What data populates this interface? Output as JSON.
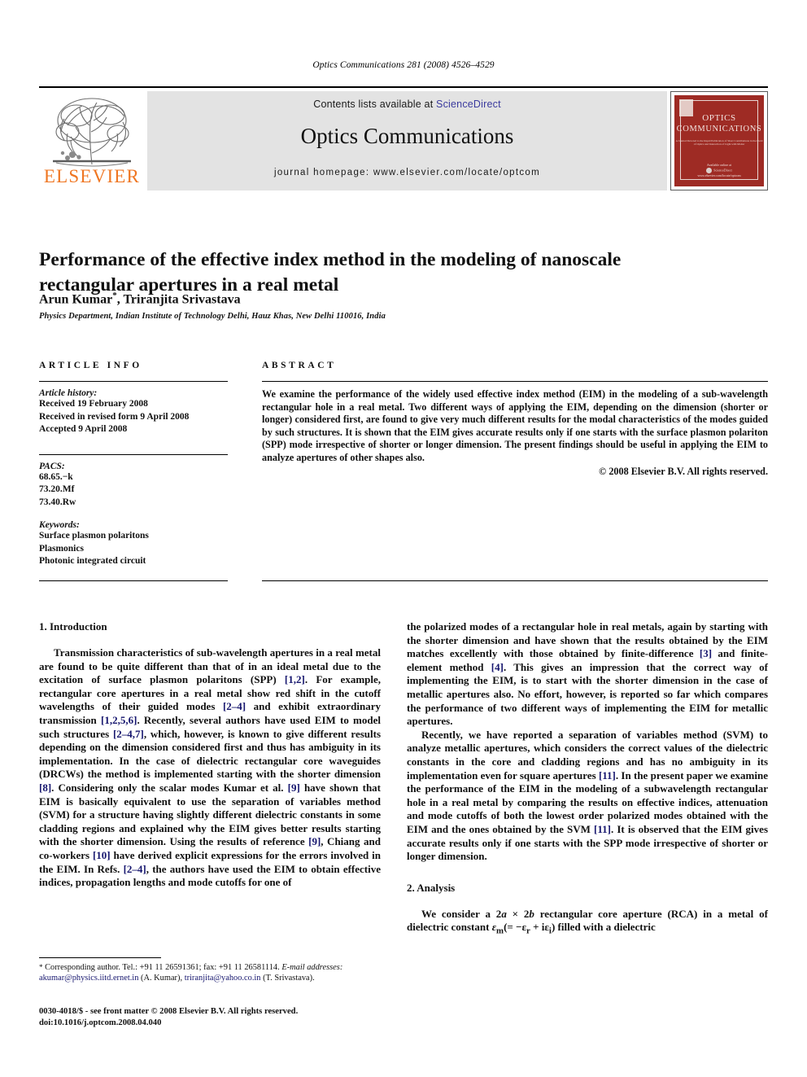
{
  "running_head": "Optics Communications 281 (2008) 4526–4529",
  "masthead": {
    "publisher_name": "ELSEVIER",
    "contents_prefix": "Contents lists available at ",
    "sciencedirect": "ScienceDirect",
    "journal_title": "Optics Communications",
    "homepage": "journal homepage: www.elsevier.com/locate/optcom",
    "cover": {
      "line1": "OPTICS",
      "line2": "COMMUNICATIONS",
      "subtitle": "A Journal Devoted to the Rapid Publication of Short Contributions in the Field of Optics and Interaction of Light with Matter",
      "footer": "Available online at",
      "footer2": "ScienceDirect",
      "footer3": "www.elsevier.com/locate/optcom"
    },
    "colors": {
      "band": "#e3e3e3",
      "elsevier_orange": "#ef7622",
      "link_blue": "#3b3b9e",
      "cover_red": "#9e2b24"
    }
  },
  "article": {
    "title": "Performance of the effective index method in the modeling of nanoscale rectangular apertures in a real metal",
    "authors": "Arun Kumar",
    "author_marker": "*",
    "authors_rest": ", Triranjita Srivastava",
    "affiliation": "Physics Department, Indian Institute of Technology Delhi, Hauz Khas, New Delhi 110016, India"
  },
  "article_info": {
    "heading": "ARTICLE INFO",
    "history_label": "Article history:",
    "history": [
      "Received 19 February 2008",
      "Received in revised form 9 April 2008",
      "Accepted 9 April 2008"
    ],
    "pacs_label": "PACS:",
    "pacs": [
      "68.65.−k",
      "73.20.Mf",
      "73.40.Rw"
    ],
    "keywords_label": "Keywords:",
    "keywords": [
      "Surface plasmon polaritons",
      "Plasmonics",
      "Photonic integrated circuit"
    ]
  },
  "abstract": {
    "heading": "ABSTRACT",
    "text": "We examine the performance of the widely used effective index method (EIM) in the modeling of a sub-wavelength rectangular hole in a real metal. Two different ways of applying the EIM, depending on the dimension (shorter or longer) considered first, are found to give very much different results for the modal characteristics of the modes guided by such structures. It is shown that the EIM gives accurate results only if one starts with the surface plasmon polariton (SPP) mode irrespective of shorter or longer dimension. The present findings should be useful in applying the EIM to analyze apertures of other shapes also.",
    "copyright": "© 2008 Elsevier B.V. All rights reserved."
  },
  "body": {
    "section1_heading": "1. Introduction",
    "section1_p1_a": "Transmission characteristics of sub-wavelength apertures in a real metal are found to be quite different than that of in an ideal metal due to the excitation of surface plasmon polaritons (SPP) ",
    "section1_p1_r1": "[1,2]",
    "section1_p1_b": ". For example, rectangular core apertures in a real metal show red shift in the cutoff wavelengths of their guided modes ",
    "section1_p1_r2": "[2–4]",
    "section1_p1_c": " and exhibit extraordinary transmission ",
    "section1_p1_r3": "[1,2,5,6]",
    "section1_p1_d": ". Recently, several authors have used EIM to model such structures ",
    "section1_p1_r4": "[2–4,7]",
    "section1_p1_e": ", which, however, is known to give different results depending on the dimension considered first and thus has ambiguity in its implementation. In the case of dielectric rectangular core waveguides (DRCWs) the method is implemented starting with the shorter dimension ",
    "section1_p1_r5": "[8]",
    "section1_p1_f": ". Considering only the scalar modes Kumar et al. ",
    "section1_p1_r6": "[9]",
    "section1_p1_g": " have shown that EIM is basically equivalent to use the separation of variables method (SVM) for a structure having slightly different dielectric constants in some cladding regions and explained why the EIM gives better results starting with the shorter dimension. Using the results of reference ",
    "section1_p1_r7": "[9]",
    "section1_p1_h": ", Chiang and co-workers ",
    "section1_p1_r8": "[10]",
    "section1_p1_i": " have derived explicit expressions for the errors involved in the EIM. In Refs. ",
    "section1_p1_r9": "[2–4]",
    "section1_p1_j": ", the authors have used the EIM to obtain effective indices, propagation lengths and mode cutoffs for one of",
    "right_p1_a": "the polarized modes of a rectangular hole in real metals, again by starting with the shorter dimension and have shown that the results obtained by the EIM matches excellently with those obtained by finite-difference ",
    "right_p1_r1": "[3]",
    "right_p1_b": " and finite-element method ",
    "right_p1_r2": "[4]",
    "right_p1_c": ". This gives an impression that the correct way of implementing the EIM, is to start with the shorter dimension in the case of metallic apertures also. No effort, however, is reported so far which compares the performance of two different ways of implementing the EIM for metallic apertures.",
    "right_p2_a": "Recently, we have reported a separation of variables method (SVM) to analyze metallic apertures, which considers the correct values of the dielectric constants in the core and cladding regions and has no ambiguity in its implementation even for square apertures ",
    "right_p2_r1": "[11]",
    "right_p2_b": ". In the present paper we examine the performance of the EIM in the modeling of a subwavelength rectangular hole in a real metal by comparing the results on effective indices, attenuation and mode cutoffs of both the lowest order polarized modes obtained with the EIM and the ones obtained by the SVM ",
    "right_p2_r2": "[11]",
    "right_p2_c": ". It is observed that the EIM gives accurate results only if one starts with the SPP mode irrespective of shorter or longer dimension.",
    "section2_heading": "2. Analysis",
    "section2_p1_a": "We consider a 2",
    "section2_p1_i1": "a",
    "section2_p1_b": " × 2",
    "section2_p1_i2": "b",
    "section2_p1_c": " rectangular core aperture (RCA) in a metal of dielectric constant ",
    "section2_p1_eps": "ε",
    "section2_p1_sub": "m",
    "section2_p1_d": "(= −ε",
    "section2_p1_subr": "r",
    "section2_p1_e": " + iε",
    "section2_p1_subi": "i",
    "section2_p1_f": ") filled with a dielectric"
  },
  "footnote": {
    "marker": "*",
    "corresponding": " Corresponding author. Tel.: +91 11 26591361; fax: +91 11 26581114.",
    "email_label": "E-mail addresses:",
    "email1": "akumar@physics.iitd.ernet.in",
    "email1_owner": " (A. Kumar), ",
    "email2": "triranjita@yahoo.co.in",
    "email2_owner": " (T. Srivastava).",
    "imprint_line1": "0030-4018/$ - see front matter © 2008 Elsevier B.V. All rights reserved.",
    "imprint_line2": "doi:10.1016/j.optcom.2008.04.040"
  }
}
